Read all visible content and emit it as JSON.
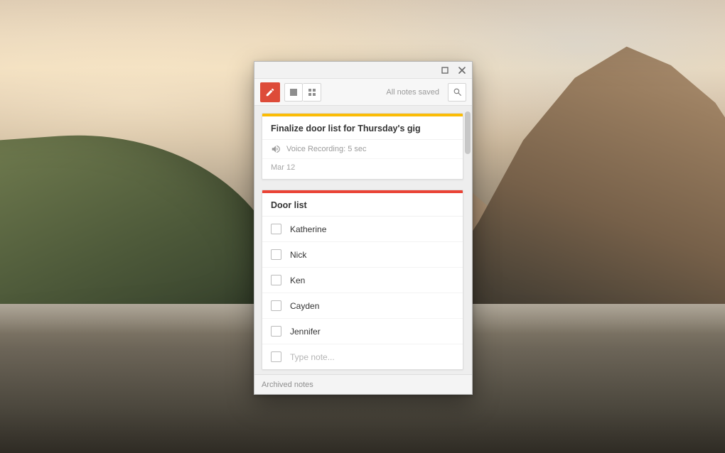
{
  "toolbar": {
    "status": "All notes saved"
  },
  "note1": {
    "title": "Finalize door list for Thursday's gig",
    "recording_label": "Voice Recording: 5 sec",
    "date": "Mar 12"
  },
  "note2": {
    "title": "Door list",
    "items": [
      "Katherine",
      "Nick",
      "Ken",
      "Cayden",
      "Jennifer"
    ],
    "new_placeholder": "Type note..."
  },
  "footer": {
    "archived_label": "Archived notes"
  }
}
